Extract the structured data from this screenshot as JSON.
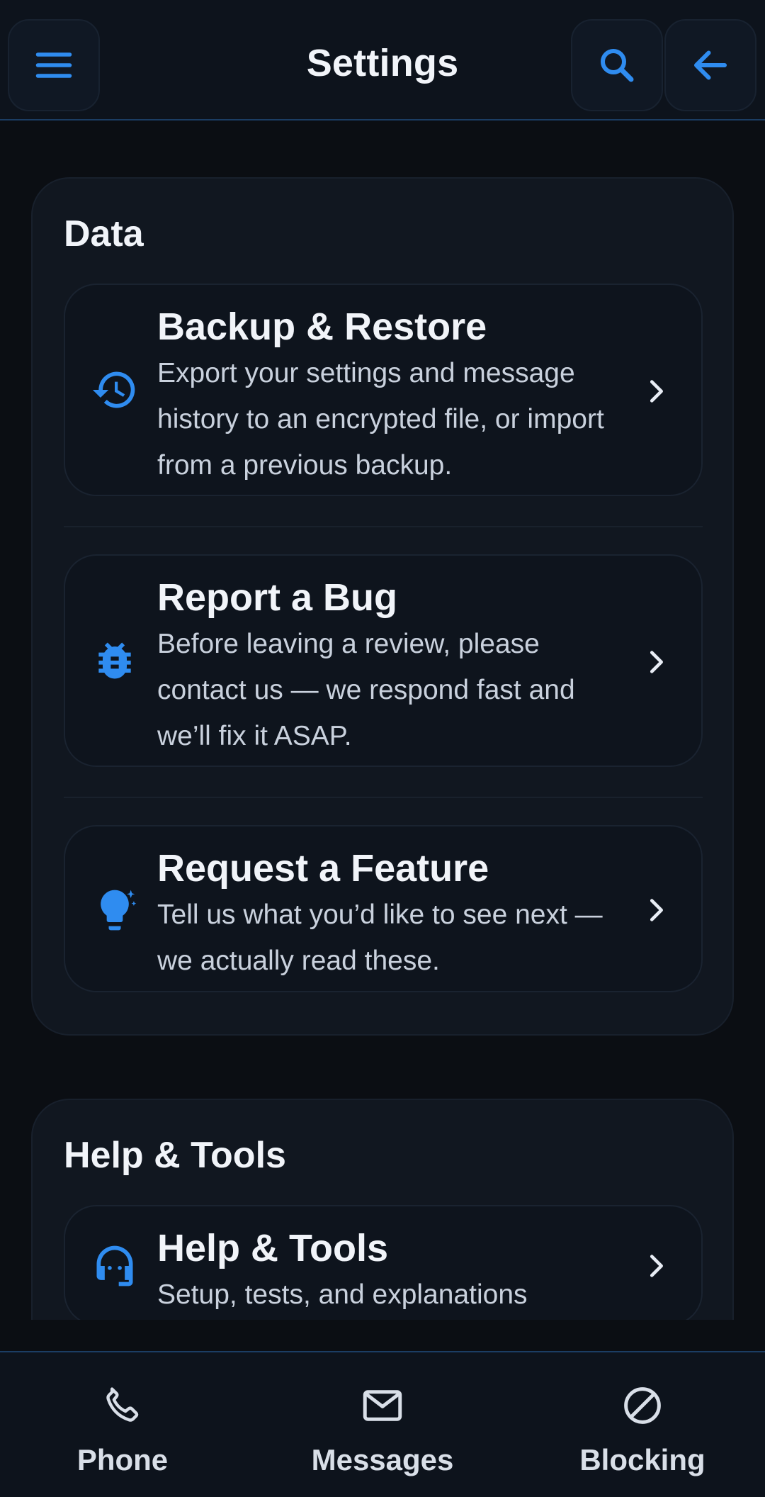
{
  "appbar": {
    "title": "Settings",
    "menu_icon": "menu-icon",
    "search_icon": "search-icon",
    "back_icon": "arrow-back-icon"
  },
  "sections": {
    "data": {
      "title": "Data",
      "items": [
        {
          "title": "Backup & Restore",
          "description": "Export your settings and message history to an encrypted file, or import from a previous backup.",
          "icon": "history-icon"
        },
        {
          "title": "Report a Bug",
          "description": "Before leaving a review, please contact us — we respond fast and we’ll fix it ASAP.",
          "icon": "bug-icon"
        },
        {
          "title": "Request a Feature",
          "description": "Tell us what you’d like to see next — we actually read these.",
          "icon": "lightbulb-icon"
        }
      ]
    },
    "help": {
      "title": "Help & Tools",
      "items": [
        {
          "title": "Help & Tools",
          "description": "Setup, tests, and explanations",
          "icon": "headset-icon"
        }
      ]
    }
  },
  "bottom_nav": {
    "items": [
      {
        "label": "Phone",
        "icon": "phone-icon"
      },
      {
        "label": "Messages",
        "icon": "mail-icon"
      },
      {
        "label": "Blocking",
        "icon": "block-icon"
      }
    ]
  },
  "colors": {
    "accent": "#2f8cf0",
    "background": "#0b0e13",
    "card": "#111720",
    "text": "#f1f4f9"
  }
}
